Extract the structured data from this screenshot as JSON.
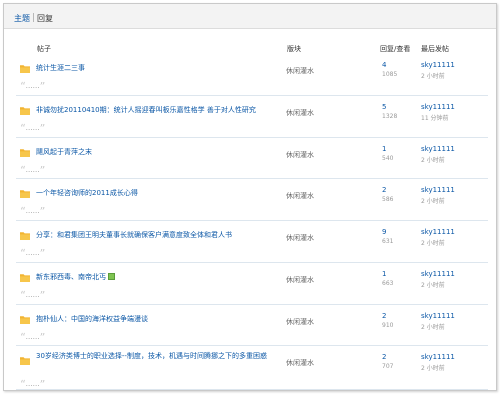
{
  "tabs": {
    "topics": "主题",
    "replies": "回复"
  },
  "header": {
    "post": "帖子",
    "board": "版块",
    "stats": "回复/查看",
    "last": "最后发帖"
  },
  "quote": {
    "open": "“",
    "dots": "……",
    "close": "”"
  },
  "rows": [
    {
      "title": "统计生涯二三事",
      "board": "休闲灌水",
      "replies": "4",
      "views": "1085",
      "author": "sky11111",
      "time": "2 小时前",
      "attachment": false
    },
    {
      "title": "非诚勿扰20110410期：统计人摇迎春叫板乐嘉性格学 善于对人性研究",
      "board": "休闲灌水",
      "replies": "5",
      "views": "1328",
      "author": "sky11111",
      "time": "11 分钟前",
      "attachment": false
    },
    {
      "title": "飓风起于青萍之末",
      "board": "休闲灌水",
      "replies": "1",
      "views": "540",
      "author": "sky11111",
      "time": "2 小时前",
      "attachment": false
    },
    {
      "title": "一个年轻咨询师的2011成长心得",
      "board": "休闲灌水",
      "replies": "2",
      "views": "586",
      "author": "sky11111",
      "time": "2 小时前",
      "attachment": false
    },
    {
      "title": "分享：和君集团王明夫董事长就确保客户满意度致全体和君人书",
      "board": "休闲灌水",
      "replies": "9",
      "views": "631",
      "author": "sky11111",
      "time": "2 小时前",
      "attachment": false
    },
    {
      "title": "新东邪西毒、南帝北丐",
      "board": "休闲灌水",
      "replies": "1",
      "views": "663",
      "author": "sky11111",
      "time": "2 小时前",
      "attachment": true
    },
    {
      "title": "抱朴仙人：中国的海洋权益争端漫谈",
      "board": "休闲灌水",
      "replies": "2",
      "views": "910",
      "author": "sky11111",
      "time": "2 小时前",
      "attachment": false
    },
    {
      "title": "30岁经济类博士的职业选择--制度，技术，机遇与时间腾挪之下的多重困惑",
      "board": "休闲灌水",
      "replies": "2",
      "views": "707",
      "author": "sky11111",
      "time": "2 小时前",
      "attachment": false
    }
  ]
}
